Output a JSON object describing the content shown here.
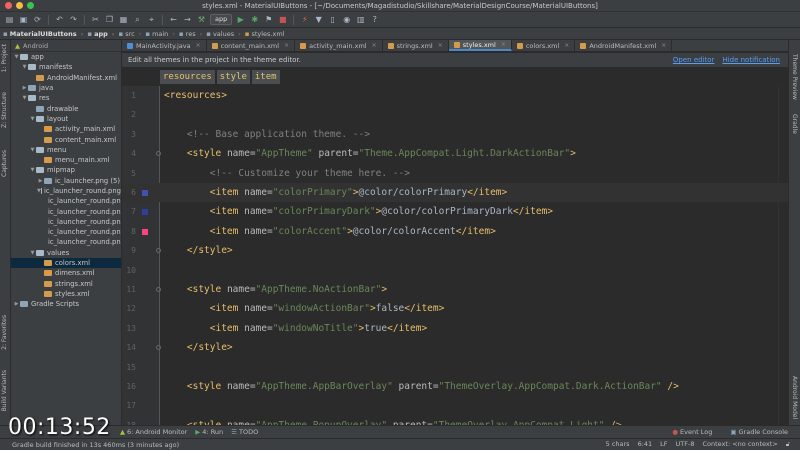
{
  "window": {
    "title": "styles.xml - MaterialUIButtons - [~/Documents/Magadistudio/Skillshare/MaterialDesignCourse/MaterialUIButtons]"
  },
  "toolbar": {
    "run_config": "app"
  },
  "navbar": {
    "crumbs": [
      "MaterialUIButtons",
      "app",
      "src",
      "main",
      "res",
      "values",
      "styles.xml"
    ]
  },
  "left_strip": {
    "tabs": [
      "1: Project",
      "Z: Structure",
      "Captures",
      "2: Favorites",
      "Build Variants"
    ]
  },
  "right_strip": {
    "tabs": [
      "Theme Preview",
      "Gradle",
      "Android Model"
    ]
  },
  "project": {
    "header": "Android",
    "tree": [
      {
        "label": "app",
        "depth": 0,
        "arrow": "▼",
        "icon": "fold-open"
      },
      {
        "label": "manifests",
        "depth": 1,
        "arrow": "▼",
        "icon": "fold-open"
      },
      {
        "label": "AndroidManifest.xml",
        "depth": 2,
        "arrow": "",
        "icon": "xml"
      },
      {
        "label": "java",
        "depth": 1,
        "arrow": "▶",
        "icon": "fold"
      },
      {
        "label": "res",
        "depth": 1,
        "arrow": "▼",
        "icon": "fold-open"
      },
      {
        "label": "drawable",
        "depth": 2,
        "arrow": "",
        "icon": "fold"
      },
      {
        "label": "layout",
        "depth": 2,
        "arrow": "▼",
        "icon": "fold-open"
      },
      {
        "label": "activity_main.xml",
        "depth": 3,
        "arrow": "",
        "icon": "xml"
      },
      {
        "label": "content_main.xml",
        "depth": 3,
        "arrow": "",
        "icon": "xml"
      },
      {
        "label": "menu",
        "depth": 2,
        "arrow": "▼",
        "icon": "fold-open"
      },
      {
        "label": "menu_main.xml",
        "depth": 3,
        "arrow": "",
        "icon": "xml"
      },
      {
        "label": "mipmap",
        "depth": 2,
        "arrow": "▼",
        "icon": "fold-open"
      },
      {
        "label": "ic_launcher.png (5)",
        "depth": 3,
        "arrow": "▶",
        "icon": "fold"
      },
      {
        "label": "ic_launcher_round.png",
        "depth": 3,
        "arrow": "▼",
        "icon": "fold-open"
      },
      {
        "label": "ic_launcher_round.png",
        "depth": 4,
        "arrow": "",
        "icon": "png"
      },
      {
        "label": "ic_launcher_round.png",
        "depth": 4,
        "arrow": "",
        "icon": "png"
      },
      {
        "label": "ic_launcher_round.png",
        "depth": 4,
        "arrow": "",
        "icon": "png"
      },
      {
        "label": "ic_launcher_round.png",
        "depth": 4,
        "arrow": "",
        "icon": "png"
      },
      {
        "label": "ic_launcher_round.png",
        "depth": 4,
        "arrow": "",
        "icon": "png"
      },
      {
        "label": "values",
        "depth": 2,
        "arrow": "▼",
        "icon": "fold-open"
      },
      {
        "label": "colors.xml",
        "depth": 3,
        "arrow": "",
        "icon": "xml",
        "selected": true
      },
      {
        "label": "dimens.xml",
        "depth": 3,
        "arrow": "",
        "icon": "xml"
      },
      {
        "label": "strings.xml",
        "depth": 3,
        "arrow": "",
        "icon": "xml"
      },
      {
        "label": "styles.xml",
        "depth": 3,
        "arrow": "",
        "icon": "xml"
      },
      {
        "label": "Gradle Scripts",
        "depth": 0,
        "arrow": "▶",
        "icon": "fold"
      }
    ]
  },
  "tabs": [
    {
      "label": "MainActivity.java",
      "icon_color": "#4a90d9",
      "active": false
    },
    {
      "label": "content_main.xml",
      "icon_color": "#d69a4a",
      "active": false
    },
    {
      "label": "activity_main.xml",
      "icon_color": "#d69a4a",
      "active": false
    },
    {
      "label": "strings.xml",
      "icon_color": "#d69a4a",
      "active": false
    },
    {
      "label": "styles.xml",
      "icon_color": "#d69a4a",
      "active": true
    },
    {
      "label": "colors.xml",
      "icon_color": "#d69a4a",
      "active": false
    },
    {
      "label": "AndroidManifest.xml",
      "icon_color": "#d69a4a",
      "active": false
    }
  ],
  "notice": {
    "text": "Edit all themes in the project in the theme editor.",
    "open_editor": "Open editor",
    "hide_notification": "Hide notification"
  },
  "tag_breadcrumb": [
    "resources",
    "style",
    "item"
  ],
  "editor": {
    "current_line": 6,
    "lines": [
      {
        "n": "1",
        "html": "<span class='tag'>&lt;resources&gt;</span>"
      },
      {
        "n": "2",
        "html": ""
      },
      {
        "n": "3",
        "html": "    <span class='cmt'>&lt;!-- Base application theme. --&gt;</span>"
      },
      {
        "n": "4",
        "html": "    <span class='tag'>&lt;style </span><span class='attr'>name=</span><span class='str'>\"AppTheme\"</span><span class='attr'> parent=</span><span class='str'>\"Theme.AppCompat.Light.DarkActionBar\"</span><span class='tag'>&gt;</span>"
      },
      {
        "n": "5",
        "html": "        <span class='cmt'>&lt;!-- Customize your theme here. --&gt;</span>"
      },
      {
        "n": "6",
        "html": "        <span class='tag'>&lt;item </span><span class='attr'>name=</span><span class='str'>\"colorPrimary\"</span><span class='tag'>&gt;</span>@color/colorPrimary<span class='tag'>&lt;/item&gt;</span>",
        "swatch": "#3f51b5"
      },
      {
        "n": "7",
        "html": "        <span class='tag'>&lt;item </span><span class='attr'>name=</span><span class='str'>\"colorPrimaryDark\"</span><span class='tag'>&gt;</span>@color/colorPrimaryDark<span class='tag'>&lt;/item&gt;</span>",
        "swatch": "#303f9f"
      },
      {
        "n": "8",
        "html": "        <span class='tag'>&lt;item </span><span class='attr'>name=</span><span class='str'>\"colorAccent\"</span><span class='tag'>&gt;</span>@color/colorAccent<span class='tag'>&lt;/item&gt;</span>",
        "swatch": "#ff4081"
      },
      {
        "n": "9",
        "html": "    <span class='tag'>&lt;/style&gt;</span>"
      },
      {
        "n": "10",
        "html": ""
      },
      {
        "n": "11",
        "html": "    <span class='tag'>&lt;style </span><span class='attr'>name=</span><span class='str'>\"AppTheme.NoActionBar\"</span><span class='tag'>&gt;</span>"
      },
      {
        "n": "12",
        "html": "        <span class='tag'>&lt;item </span><span class='attr'>name=</span><span class='str'>\"windowActionBar\"</span><span class='tag'>&gt;</span>false<span class='tag'>&lt;/item&gt;</span>"
      },
      {
        "n": "13",
        "html": "        <span class='tag'>&lt;item </span><span class='attr'>name=</span><span class='str'>\"windowNoTitle\"</span><span class='tag'>&gt;</span>true<span class='tag'>&lt;/item&gt;</span>"
      },
      {
        "n": "14",
        "html": "    <span class='tag'>&lt;/style&gt;</span>"
      },
      {
        "n": "15",
        "html": ""
      },
      {
        "n": "16",
        "html": "    <span class='tag'>&lt;style </span><span class='attr'>name=</span><span class='str'>\"AppTheme.AppBarOverlay\"</span><span class='attr'> parent=</span><span class='str'>\"ThemeOverlay.AppCompat.Dark.ActionBar\"</span><span class='tag'> /&gt;</span>"
      },
      {
        "n": "17",
        "html": ""
      },
      {
        "n": "18",
        "html": "    <span class='tag'>&lt;style </span><span class='attr'>name=</span><span class='str'>\"AppTheme.PopupOverlay\"</span><span class='attr'> parent=</span><span class='str'>\"ThemeOverlay.AppCompat.Light\"</span><span class='tag'> /&gt;</span>"
      }
    ]
  },
  "bottom_tools": {
    "left": [
      "6: Android Monitor",
      "4: Run",
      "TODO"
    ],
    "right": [
      "Event Log",
      "Gradle Console"
    ]
  },
  "status": {
    "message": "Gradle build finished in 13s 460ms (3 minutes ago)",
    "chars": "5 chars",
    "position": "6:41",
    "line_sep": "LF",
    "encoding": "UTF-8",
    "context": "Context: <no context>"
  },
  "overlay": {
    "timer": "00:13:52"
  }
}
